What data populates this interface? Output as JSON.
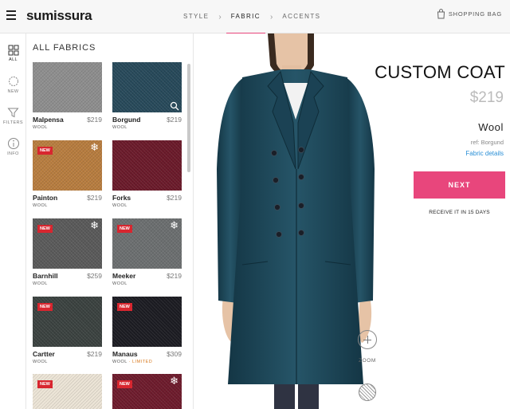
{
  "header": {
    "logo": "sumissura",
    "steps": [
      {
        "label": "STYLE",
        "active": false
      },
      {
        "label": "FABRIC",
        "active": true
      },
      {
        "label": "ACCENTS",
        "active": false
      }
    ],
    "bag_label": "SHOPPING BAG",
    "icons": {
      "menu": "menu-icon",
      "bag": "shopping-bag-icon"
    }
  },
  "toolbar": [
    {
      "label": "ALL",
      "icon": "grid-icon",
      "active": true
    },
    {
      "label": "NEW",
      "icon": "badge-icon",
      "active": false
    },
    {
      "label": "FILTERS",
      "icon": "funnel-icon",
      "active": false
    },
    {
      "label": "INFO",
      "icon": "info-icon",
      "active": false
    }
  ],
  "panel": {
    "title": "ALL FABRICS",
    "fabrics": [
      {
        "name": "Malpensa",
        "price": "$219",
        "type": "WOOL",
        "limited": "",
        "new": false,
        "winter": false,
        "zoom": false,
        "color": "#8e8e8e"
      },
      {
        "name": "Borgund",
        "price": "$219",
        "type": "WOOL",
        "limited": "",
        "new": false,
        "winter": false,
        "zoom": true,
        "color": "#27495a"
      },
      {
        "name": "Painton",
        "price": "$219",
        "type": "WOOL",
        "limited": "",
        "new": true,
        "winter": true,
        "zoom": false,
        "color": "#b87d3f"
      },
      {
        "name": "Forks",
        "price": "$219",
        "type": "WOOL",
        "limited": "",
        "new": false,
        "winter": false,
        "zoom": false,
        "color": "#6b1a2a"
      },
      {
        "name": "Barnhill",
        "price": "$259",
        "type": "WOOL",
        "limited": "",
        "new": true,
        "winter": true,
        "zoom": false,
        "color": "#5a5a5a"
      },
      {
        "name": "Meeker",
        "price": "$219",
        "type": "WOOL",
        "limited": "",
        "new": true,
        "winter": true,
        "zoom": false,
        "color": "#6c6f70"
      },
      {
        "name": "Cartter",
        "price": "$219",
        "type": "WOOL",
        "limited": "",
        "new": true,
        "winter": false,
        "zoom": false,
        "color": "#3b4240"
      },
      {
        "name": "Manaus",
        "price": "$309",
        "type": "WOOL",
        "limited": "LIMITED",
        "new": true,
        "winter": false,
        "zoom": false,
        "color": "#1c1c22"
      },
      {
        "name": "",
        "price": "",
        "type": "",
        "limited": "",
        "new": true,
        "winter": false,
        "zoom": false,
        "color": "#ece4d6"
      },
      {
        "name": "",
        "price": "",
        "type": "",
        "limited": "",
        "new": true,
        "winter": true,
        "zoom": false,
        "color": "#6e1b2c"
      }
    ]
  },
  "product": {
    "title": "CUSTOM COAT",
    "price": "$219",
    "fabric": "Wool",
    "ref": "ref: Borgund",
    "details_link": "Fabric details",
    "next_label": "NEXT",
    "delivery": "RECEIVE IT IN 15 DAYS",
    "zoom_label": "ZOOM",
    "coat_color": "#1f4a5c",
    "accent_color": "#e8467c"
  }
}
